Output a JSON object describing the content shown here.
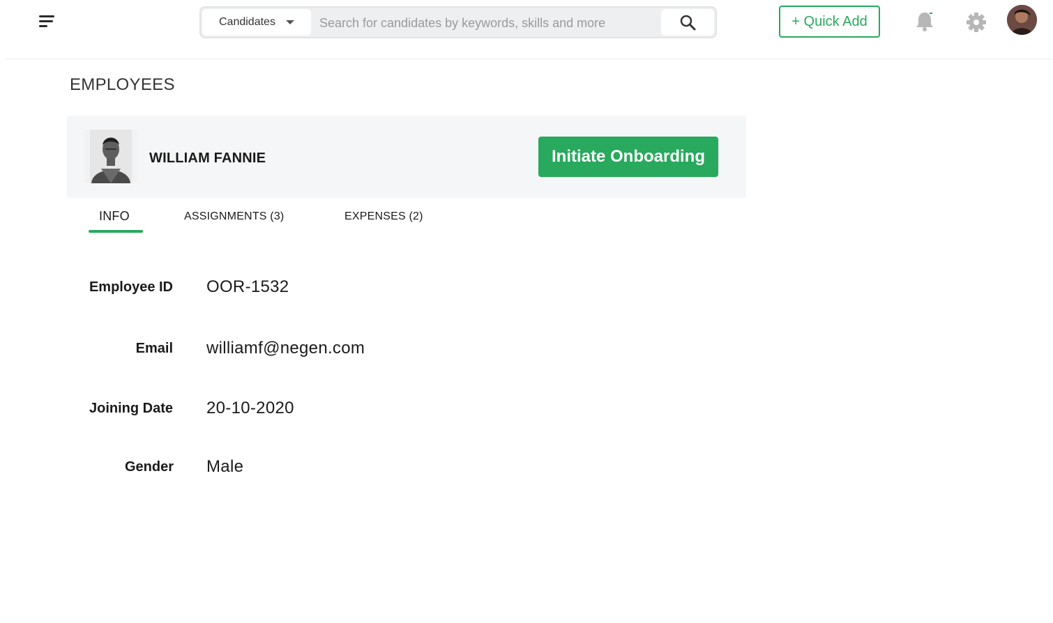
{
  "header": {
    "menu_icon": "hamburger-menu-icon",
    "search": {
      "scope": "Candidates",
      "placeholder": "Search for candidates by keywords, skills and more",
      "value": ""
    },
    "quick_add_label": "+ Quick Add",
    "icons": [
      "bell-icon",
      "gear-icon",
      "user-avatar"
    ]
  },
  "page": {
    "title": "EMPLOYEES"
  },
  "employee": {
    "name": "WILLIAM FANNIE",
    "action_label": "Initiate Onboarding"
  },
  "tabs": [
    {
      "label": "INFO",
      "active": true
    },
    {
      "label": "ASSIGNMENTS (3)",
      "active": false
    },
    {
      "label": "EXPENSES (2)",
      "active": false
    }
  ],
  "fields": [
    {
      "label": "Employee ID",
      "value": "OOR-1532"
    },
    {
      "label": "Email",
      "value": "williamf@negen.com"
    },
    {
      "label": "Joining Date",
      "value": "20-10-2020"
    },
    {
      "label": "Gender",
      "value": "Male"
    }
  ],
  "colors": {
    "accent": "#28a95d",
    "card_bg": "#f5f6f8",
    "icon_gray": "#b7b7b7"
  }
}
